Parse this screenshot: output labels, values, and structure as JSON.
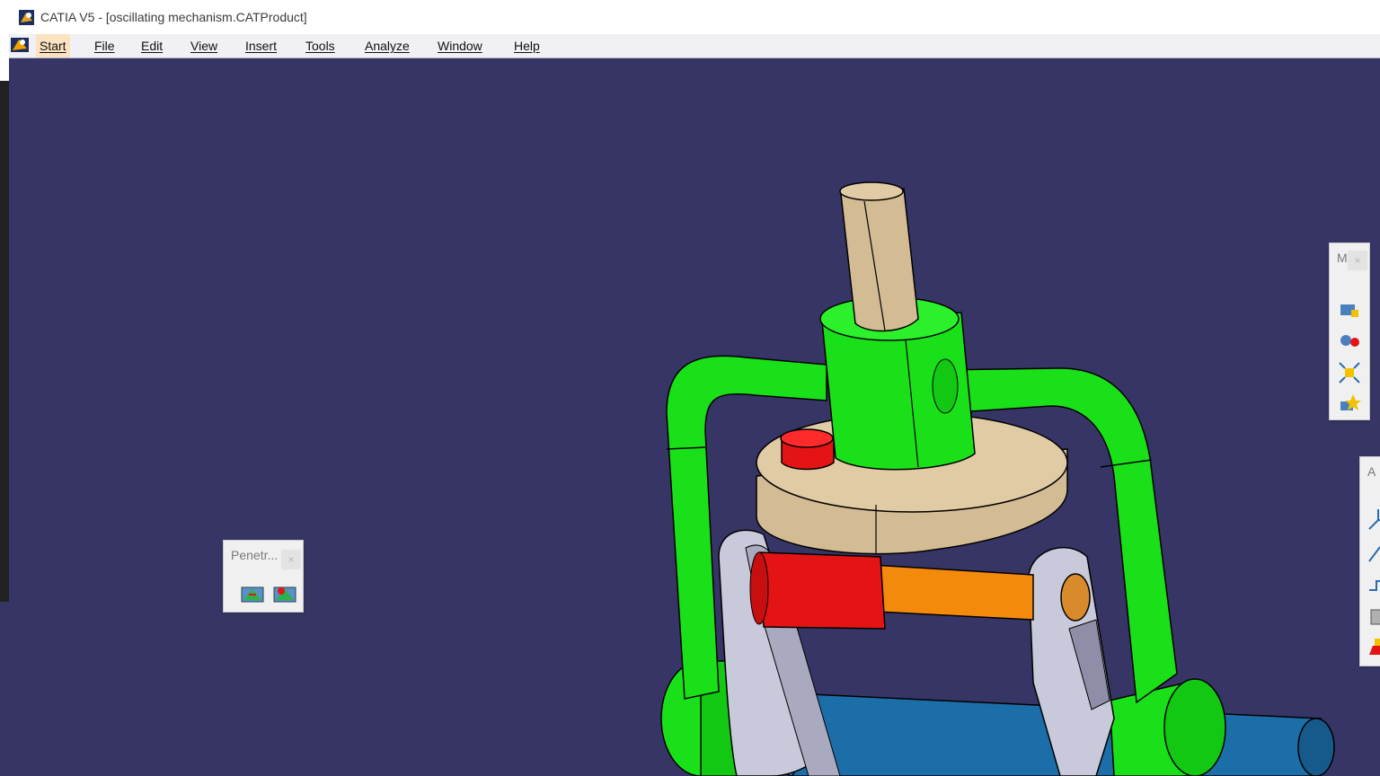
{
  "window": {
    "title": "CATIA V5 - [oscillating mechanism.CATProduct]"
  },
  "menubar": {
    "items": [
      {
        "label": "Start"
      },
      {
        "label": "File"
      },
      {
        "label": "Edit"
      },
      {
        "label": "View"
      },
      {
        "label": "Insert"
      },
      {
        "label": "Tools"
      },
      {
        "label": "Analyze"
      },
      {
        "label": "Window"
      },
      {
        "label": "Help"
      }
    ]
  },
  "toolbars": {
    "penetration": {
      "title": "Penetr...",
      "close": "×",
      "buttons": [
        "clash-icon",
        "clash-interference-icon"
      ]
    },
    "right_top": {
      "title": "M",
      "close": "×",
      "buttons": [
        "manipulation-icon",
        "snap-icon",
        "explode-icon",
        "stop-manipulate-icon"
      ]
    },
    "right_bottom": {
      "title": "A",
      "buttons": [
        "axis-icon",
        "annotation-icon",
        "flag-note-icon",
        "measure-icon",
        "analysis-icon"
      ]
    }
  },
  "colors": {
    "background": "#363565",
    "frame_green": "#1ae01a",
    "tan": "#d3bb94",
    "red": "#e41414",
    "orange": "#f48a0c",
    "blue": "#1b6ea8",
    "link_gray": "#c9c9dc"
  }
}
